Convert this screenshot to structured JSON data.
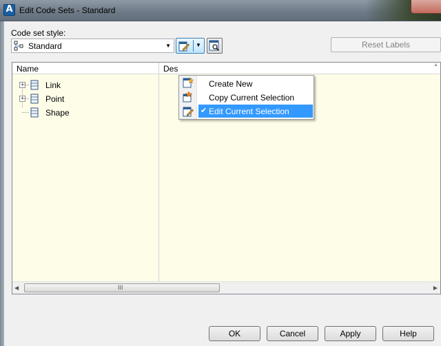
{
  "window": {
    "title": "Edit Code Sets - Standard",
    "app_icon_letter": "A"
  },
  "style_selector": {
    "label": "Code set style:",
    "selected": "Standard"
  },
  "reset_labels_label": "Reset Labels",
  "columns": [
    "Name",
    "Des"
  ],
  "tree": [
    {
      "label": "Link",
      "expandable": true
    },
    {
      "label": "Point",
      "expandable": true
    },
    {
      "label": "Shape",
      "expandable": false
    }
  ],
  "scrollbar_grip": "III",
  "menu": {
    "items": [
      {
        "label": "Create New",
        "checked": false,
        "highlighted": false
      },
      {
        "label": "Copy Current Selection",
        "checked": false,
        "highlighted": false
      },
      {
        "label": "Edit Current Selection",
        "checked": true,
        "highlighted": true
      }
    ]
  },
  "buttons": {
    "ok": "OK",
    "cancel": "Cancel",
    "apply": "Apply",
    "help": "Help"
  },
  "colors": {
    "list_background": "#fdfde8",
    "menu_highlight": "#3399ff"
  },
  "icons": {
    "app": "autocad-icon",
    "style": "code-set-style-icon",
    "edit": "edit-style-icon",
    "view": "view-details-icon"
  }
}
